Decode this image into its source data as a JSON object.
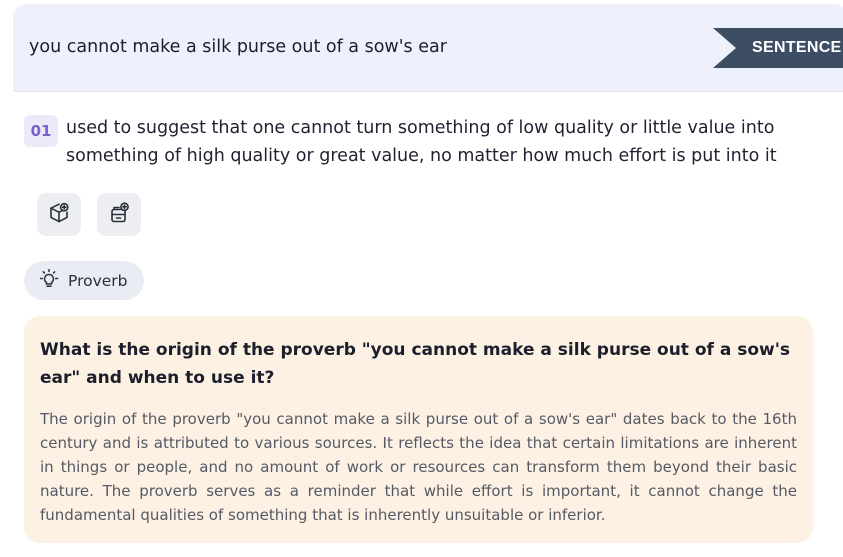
{
  "entry": {
    "phrase": "you cannot make a silk purse out of a sow's ear",
    "type_badge": "SENTENCE"
  },
  "definition": {
    "number": "01",
    "text": "used to suggest that one cannot turn something of low quality or little value into something of high quality or great value, no matter how much effort is put into it"
  },
  "tools": [
    {
      "icon": "cube-plus-icon"
    },
    {
      "icon": "box-plus-icon"
    }
  ],
  "tag": {
    "icon": "lightbulb-icon",
    "label": "Proverb"
  },
  "qa": {
    "question": "What is the origin of the proverb \"you cannot make a silk purse out of a sow's ear\" and when to use it?",
    "answer": "The origin of the proverb \"you cannot make a silk purse out of a sow's ear\" dates back to the 16th century and is attributed to various sources. It reflects the idea that certain limitations are inherent in things or people, and no amount of work or resources can transform them beyond their basic nature. The proverb serves as a reminder that while effort is important, it cannot change the fundamental qualities of something that is inherently unsuitable or inferior."
  },
  "colors": {
    "header_bg": "#eef0fc",
    "badge_bg": "#3d4d63",
    "number_accent": "#7a5fcf",
    "qa_bg": "#fdf1e4"
  }
}
